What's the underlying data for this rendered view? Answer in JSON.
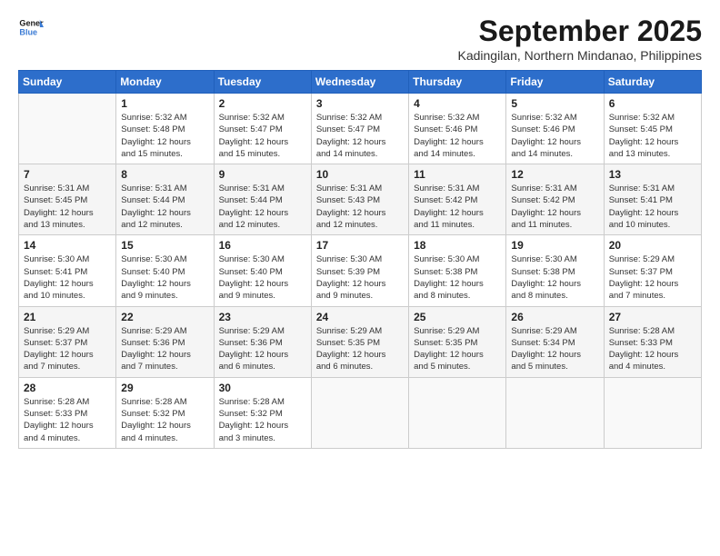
{
  "header": {
    "logo_line1": "General",
    "logo_line2": "Blue",
    "month": "September 2025",
    "location": "Kadingilan, Northern Mindanao, Philippines"
  },
  "weekdays": [
    "Sunday",
    "Monday",
    "Tuesday",
    "Wednesday",
    "Thursday",
    "Friday",
    "Saturday"
  ],
  "weeks": [
    [
      {
        "day": "",
        "info": ""
      },
      {
        "day": "1",
        "info": "Sunrise: 5:32 AM\nSunset: 5:48 PM\nDaylight: 12 hours\nand 15 minutes."
      },
      {
        "day": "2",
        "info": "Sunrise: 5:32 AM\nSunset: 5:47 PM\nDaylight: 12 hours\nand 15 minutes."
      },
      {
        "day": "3",
        "info": "Sunrise: 5:32 AM\nSunset: 5:47 PM\nDaylight: 12 hours\nand 14 minutes."
      },
      {
        "day": "4",
        "info": "Sunrise: 5:32 AM\nSunset: 5:46 PM\nDaylight: 12 hours\nand 14 minutes."
      },
      {
        "day": "5",
        "info": "Sunrise: 5:32 AM\nSunset: 5:46 PM\nDaylight: 12 hours\nand 14 minutes."
      },
      {
        "day": "6",
        "info": "Sunrise: 5:32 AM\nSunset: 5:45 PM\nDaylight: 12 hours\nand 13 minutes."
      }
    ],
    [
      {
        "day": "7",
        "info": "Sunrise: 5:31 AM\nSunset: 5:45 PM\nDaylight: 12 hours\nand 13 minutes."
      },
      {
        "day": "8",
        "info": "Sunrise: 5:31 AM\nSunset: 5:44 PM\nDaylight: 12 hours\nand 12 minutes."
      },
      {
        "day": "9",
        "info": "Sunrise: 5:31 AM\nSunset: 5:44 PM\nDaylight: 12 hours\nand 12 minutes."
      },
      {
        "day": "10",
        "info": "Sunrise: 5:31 AM\nSunset: 5:43 PM\nDaylight: 12 hours\nand 12 minutes."
      },
      {
        "day": "11",
        "info": "Sunrise: 5:31 AM\nSunset: 5:42 PM\nDaylight: 12 hours\nand 11 minutes."
      },
      {
        "day": "12",
        "info": "Sunrise: 5:31 AM\nSunset: 5:42 PM\nDaylight: 12 hours\nand 11 minutes."
      },
      {
        "day": "13",
        "info": "Sunrise: 5:31 AM\nSunset: 5:41 PM\nDaylight: 12 hours\nand 10 minutes."
      }
    ],
    [
      {
        "day": "14",
        "info": "Sunrise: 5:30 AM\nSunset: 5:41 PM\nDaylight: 12 hours\nand 10 minutes."
      },
      {
        "day": "15",
        "info": "Sunrise: 5:30 AM\nSunset: 5:40 PM\nDaylight: 12 hours\nand 9 minutes."
      },
      {
        "day": "16",
        "info": "Sunrise: 5:30 AM\nSunset: 5:40 PM\nDaylight: 12 hours\nand 9 minutes."
      },
      {
        "day": "17",
        "info": "Sunrise: 5:30 AM\nSunset: 5:39 PM\nDaylight: 12 hours\nand 9 minutes."
      },
      {
        "day": "18",
        "info": "Sunrise: 5:30 AM\nSunset: 5:38 PM\nDaylight: 12 hours\nand 8 minutes."
      },
      {
        "day": "19",
        "info": "Sunrise: 5:30 AM\nSunset: 5:38 PM\nDaylight: 12 hours\nand 8 minutes."
      },
      {
        "day": "20",
        "info": "Sunrise: 5:29 AM\nSunset: 5:37 PM\nDaylight: 12 hours\nand 7 minutes."
      }
    ],
    [
      {
        "day": "21",
        "info": "Sunrise: 5:29 AM\nSunset: 5:37 PM\nDaylight: 12 hours\nand 7 minutes."
      },
      {
        "day": "22",
        "info": "Sunrise: 5:29 AM\nSunset: 5:36 PM\nDaylight: 12 hours\nand 7 minutes."
      },
      {
        "day": "23",
        "info": "Sunrise: 5:29 AM\nSunset: 5:36 PM\nDaylight: 12 hours\nand 6 minutes."
      },
      {
        "day": "24",
        "info": "Sunrise: 5:29 AM\nSunset: 5:35 PM\nDaylight: 12 hours\nand 6 minutes."
      },
      {
        "day": "25",
        "info": "Sunrise: 5:29 AM\nSunset: 5:35 PM\nDaylight: 12 hours\nand 5 minutes."
      },
      {
        "day": "26",
        "info": "Sunrise: 5:29 AM\nSunset: 5:34 PM\nDaylight: 12 hours\nand 5 minutes."
      },
      {
        "day": "27",
        "info": "Sunrise: 5:28 AM\nSunset: 5:33 PM\nDaylight: 12 hours\nand 4 minutes."
      }
    ],
    [
      {
        "day": "28",
        "info": "Sunrise: 5:28 AM\nSunset: 5:33 PM\nDaylight: 12 hours\nand 4 minutes."
      },
      {
        "day": "29",
        "info": "Sunrise: 5:28 AM\nSunset: 5:32 PM\nDaylight: 12 hours\nand 4 minutes."
      },
      {
        "day": "30",
        "info": "Sunrise: 5:28 AM\nSunset: 5:32 PM\nDaylight: 12 hours\nand 3 minutes."
      },
      {
        "day": "",
        "info": ""
      },
      {
        "day": "",
        "info": ""
      },
      {
        "day": "",
        "info": ""
      },
      {
        "day": "",
        "info": ""
      }
    ]
  ]
}
